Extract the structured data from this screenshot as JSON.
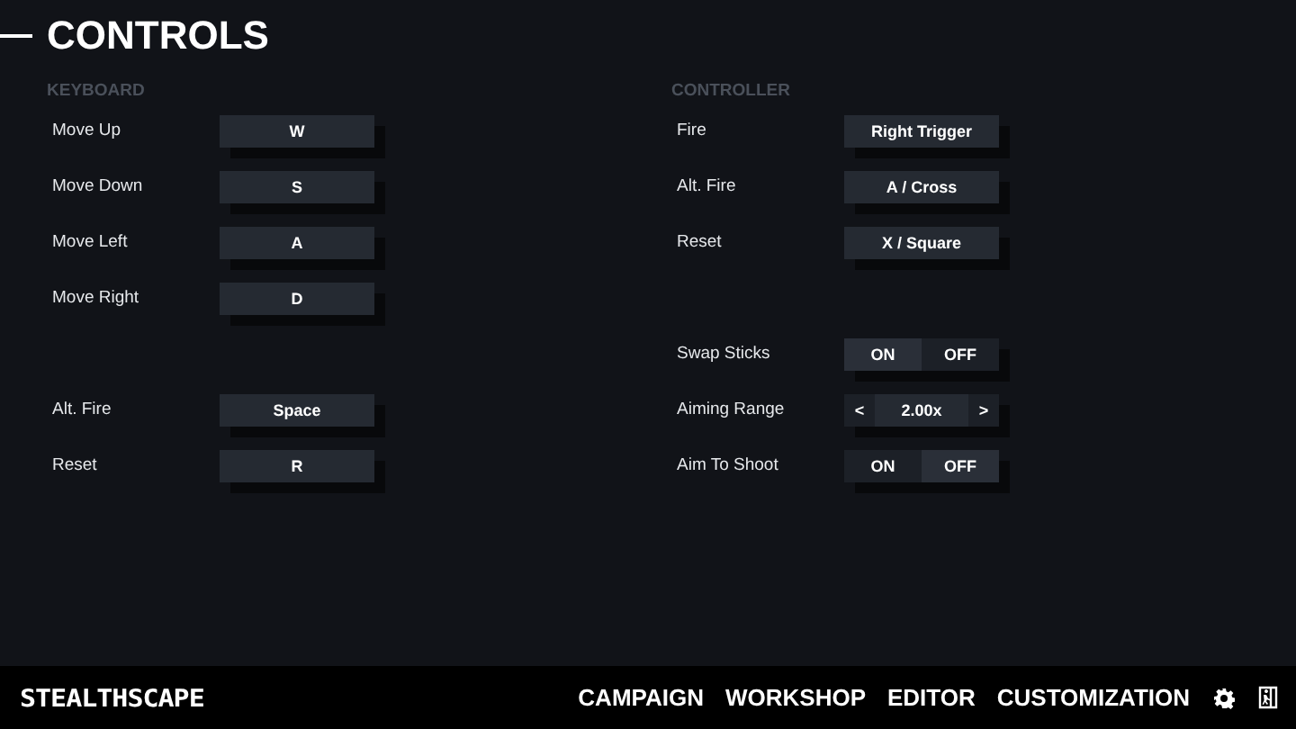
{
  "title": "CONTROLS",
  "sections": [
    {
      "heading": "KEYBOARD",
      "groups": [
        [
          {
            "kind": "key",
            "label": "Move Up",
            "value": "W"
          },
          {
            "kind": "key",
            "label": "Move Down",
            "value": "S"
          },
          {
            "kind": "key",
            "label": "Move Left",
            "value": "A"
          },
          {
            "kind": "key",
            "label": "Move Right",
            "value": "D"
          }
        ],
        [
          {
            "kind": "key",
            "label": "Alt. Fire",
            "value": "Space"
          },
          {
            "kind": "key",
            "label": "Reset",
            "value": "R"
          }
        ]
      ]
    },
    {
      "heading": "CONTROLLER",
      "groups": [
        [
          {
            "kind": "key",
            "label": "Fire",
            "value": "Right Trigger"
          },
          {
            "kind": "key",
            "label": "Alt. Fire",
            "value": "A / Cross"
          },
          {
            "kind": "key",
            "label": "Reset",
            "value": "X / Square"
          }
        ],
        [
          {
            "kind": "toggle",
            "label": "Swap Sticks",
            "options": [
              {
                "label": "ON",
                "selected": true
              },
              {
                "label": "OFF",
                "selected": false
              }
            ]
          },
          {
            "kind": "stepper",
            "label": "Aiming Range",
            "prev": "<",
            "value": "2.00x",
            "next": ">"
          },
          {
            "kind": "toggle",
            "label": "Aim To Shoot",
            "options": [
              {
                "label": "ON",
                "selected": false
              },
              {
                "label": "OFF",
                "selected": true
              }
            ]
          }
        ]
      ]
    }
  ],
  "footer": {
    "logo": "STEALTHSCAPE",
    "nav": [
      "CAMPAIGN",
      "WORKSHOP",
      "EDITOR",
      "CUSTOMIZATION"
    ]
  }
}
